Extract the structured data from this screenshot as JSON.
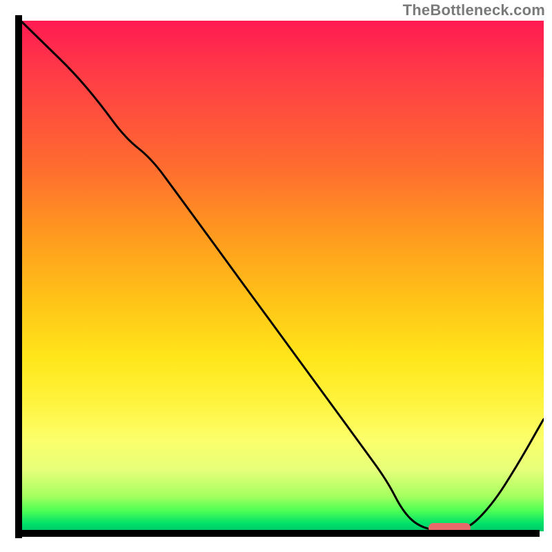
{
  "watermark": "TheBottleneck.com",
  "chart_data": {
    "type": "line",
    "title": "",
    "xlabel": "",
    "ylabel": "",
    "xlim": [
      0,
      100
    ],
    "ylim": [
      0,
      100
    ],
    "grid": false,
    "series": [
      {
        "name": "bottleneck-curve",
        "x": [
          0,
          5,
          10,
          15,
          20,
          25,
          30,
          35,
          40,
          45,
          50,
          55,
          60,
          65,
          70,
          73,
          76,
          80,
          85,
          90,
          95,
          100
        ],
        "y": [
          100,
          95,
          90,
          84,
          77,
          73,
          66,
          59,
          52,
          45,
          38,
          31,
          24,
          17,
          10,
          4,
          1,
          0,
          0,
          5,
          13,
          22
        ]
      }
    ],
    "marker": {
      "name": "optimal-zone",
      "x_start": 78,
      "x_end": 86,
      "y": 0.7,
      "color": "#e66a6a"
    },
    "background": {
      "type": "gradient-vertical",
      "stops": [
        {
          "pos": 0.0,
          "color": "#ff1a52"
        },
        {
          "pos": 0.28,
          "color": "#ff6a30"
        },
        {
          "pos": 0.55,
          "color": "#ffc417"
        },
        {
          "pos": 0.74,
          "color": "#fff23a"
        },
        {
          "pos": 0.93,
          "color": "#a7ff60"
        },
        {
          "pos": 1.0,
          "color": "#00c86a"
        }
      ]
    }
  }
}
